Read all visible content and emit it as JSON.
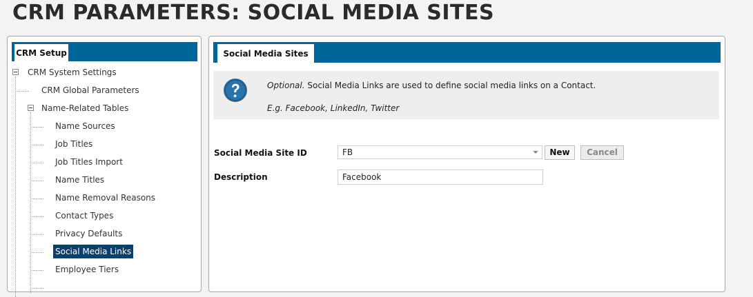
{
  "page_title": "CRM PARAMETERS: SOCIAL MEDIA SITES",
  "left_panel": {
    "tab_label": "CRM Setup",
    "tree": [
      {
        "label": "CRM System Settings",
        "level": 0,
        "expanded": true
      },
      {
        "label": "CRM Global Parameters",
        "level": 1
      },
      {
        "label": "Name-Related Tables",
        "level": 1,
        "expanded": true
      },
      {
        "label": "Name Sources",
        "level": 2
      },
      {
        "label": "Job Titles",
        "level": 2
      },
      {
        "label": "Job Titles Import",
        "level": 2
      },
      {
        "label": "Name Titles",
        "level": 2
      },
      {
        "label": "Name Removal Reasons",
        "level": 2
      },
      {
        "label": "Contact Types",
        "level": 2
      },
      {
        "label": "Privacy Defaults",
        "level": 2
      },
      {
        "label": "Social Media Links",
        "level": 2,
        "selected": true
      },
      {
        "label": "Employee Tiers",
        "level": 2
      }
    ]
  },
  "right_panel": {
    "tab_label": "Social Media Sites",
    "info": {
      "optional": "Optional.",
      "text": " Social Media Links are used to define social media links on a Contact.",
      "example": "E.g. Facebook, LinkedIn, Twitter"
    },
    "form": {
      "site_id_label": "Social Media Site ID",
      "site_id_value": "FB",
      "new_label": "New",
      "cancel_label": "Cancel",
      "description_label": "Description",
      "description_value": "Facebook"
    }
  },
  "colors": {
    "header_blue": "#006699",
    "selected_bg": "#0a3f6e"
  }
}
